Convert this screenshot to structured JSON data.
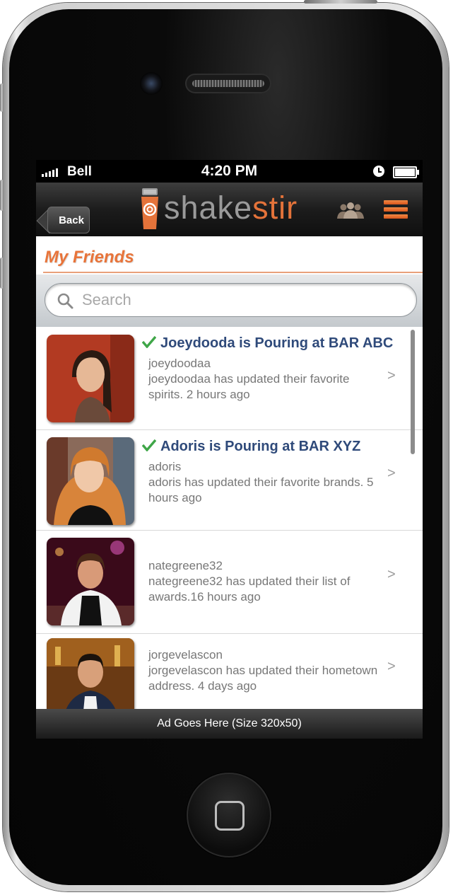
{
  "status_bar": {
    "carrier": "Bell",
    "time": "4:20 PM"
  },
  "nav": {
    "back_label": "Back",
    "logo": {
      "part1": "shake",
      "part2": "stir"
    },
    "accent_color": "#e8743a"
  },
  "page": {
    "title": "My Friends"
  },
  "search": {
    "placeholder": "Search",
    "value": ""
  },
  "feed": {
    "items": [
      {
        "title": "Joeydooda is Pouring at BAR ABC",
        "checked": true,
        "username": "joeydoodaa",
        "description": "joeydoodaa has updated their favorite spirits. 2 hours ago",
        "chevron": ">"
      },
      {
        "title": "Adoris is Pouring at BAR XYZ",
        "checked": true,
        "username": "adoris",
        "description": "adoris has updated their favorite brands. 5 hours ago",
        "chevron": ">"
      },
      {
        "title": "",
        "checked": false,
        "username": "nategreene32",
        "description": "nategreene32 has updated their list of awards.16 hours ago",
        "chevron": ">"
      },
      {
        "title": "",
        "checked": false,
        "username": "jorgevelascon",
        "description": "jorgevelascon has updated their hometown address. 4 days ago",
        "chevron": ">"
      }
    ]
  },
  "ad": {
    "text": "Ad Goes Here (Size 320x50)"
  }
}
